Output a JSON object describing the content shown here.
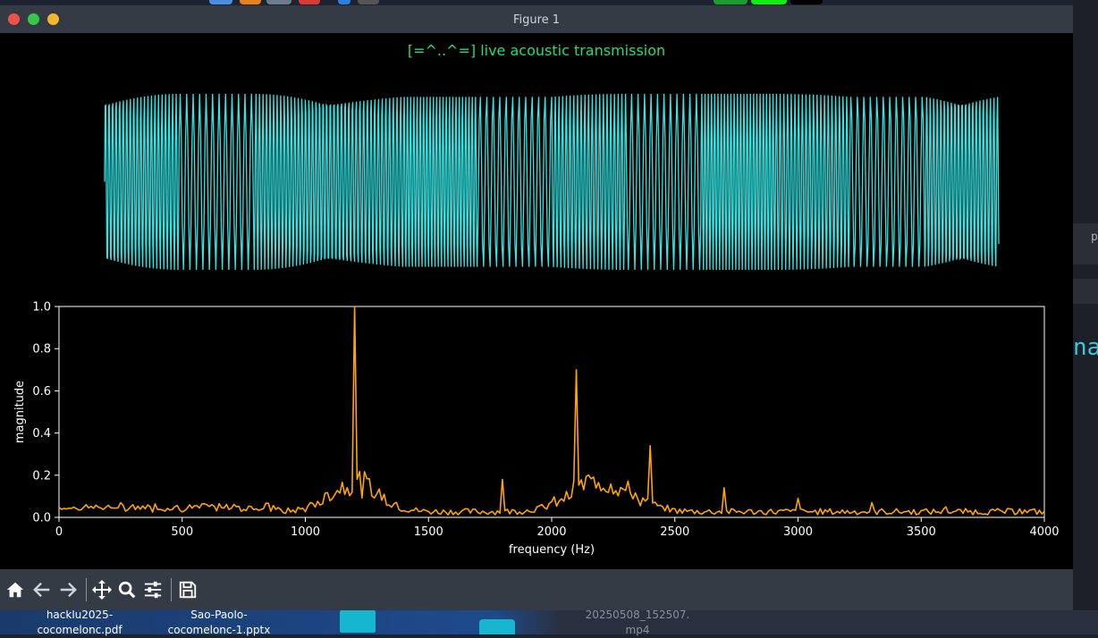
{
  "window": {
    "title": "Figure 1"
  },
  "figure": {
    "title": "[=^..^=] live acoustic transmission",
    "title_color": "#22dd77",
    "waveform_color": "#33e6e6",
    "spectrum_color": "#ffa500"
  },
  "chart_data": [
    {
      "type": "line",
      "title": "",
      "xlabel": "",
      "ylabel": "",
      "axes_visible": false,
      "description_values": "FSK-like waveform oscillating between -1 and 1",
      "ylim": [
        -1,
        1
      ],
      "segments_hz": [
        2200,
        1200,
        2200,
        2100,
        2400,
        1200,
        2100,
        1200,
        2400,
        2100,
        1200,
        2200
      ]
    },
    {
      "type": "line",
      "title": "",
      "xlabel": "frequency (Hz)",
      "ylabel": "magnitude",
      "xlim": [
        0,
        4000
      ],
      "ylim": [
        0.0,
        1.0
      ],
      "xticks": [
        "0",
        "500",
        "1000",
        "1500",
        "2000",
        "2500",
        "3000",
        "3500",
        "4000"
      ],
      "yticks": [
        "0.0",
        "0.2",
        "0.4",
        "0.6",
        "0.8",
        "1.0"
      ],
      "grid": false,
      "peaks": [
        {
          "x": 1200,
          "y": 1.0
        },
        {
          "x": 2100,
          "y": 0.7
        },
        {
          "x": 2400,
          "y": 0.34
        },
        {
          "x": 1800,
          "y": 0.18
        },
        {
          "x": 2700,
          "y": 0.14
        },
        {
          "x": 3000,
          "y": 0.09
        },
        {
          "x": 3300,
          "y": 0.07
        },
        {
          "x": 3600,
          "y": 0.05
        },
        {
          "x": 3900,
          "y": 0.04
        },
        {
          "x": 300,
          "y": 0.06
        },
        {
          "x": 600,
          "y": 0.06
        }
      ]
    }
  ],
  "toolbar": {
    "buttons": [
      "home-icon",
      "back-icon",
      "forward-icon",
      "pan-icon",
      "zoom-icon",
      "configure-subplots-icon",
      "save-icon"
    ]
  },
  "desktop": {
    "files": [
      {
        "line1": "hacklu2025-",
        "line2": "cocomelonc.pdf"
      },
      {
        "line1": "Sao-Paolo-",
        "line2": "cocomelonc-1.pptx"
      },
      {
        "line1": "20250508_152507.",
        "line2": "mp4"
      }
    ],
    "side_text": "nal",
    "side_letter": "p"
  }
}
